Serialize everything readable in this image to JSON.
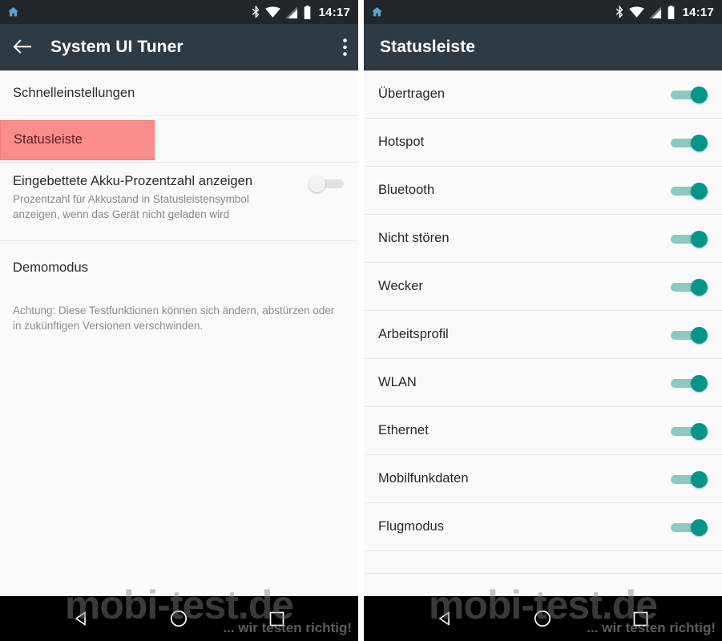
{
  "statusbar": {
    "home_icon": "home-icon",
    "bluetooth_icon": "bluetooth-icon",
    "wifi_icon": "wifi-icon",
    "signal_icon": "cellular-signal-icon",
    "battery_icon": "battery-icon",
    "time": "14:17"
  },
  "left_panel": {
    "appbar": {
      "back_icon": "back-arrow-icon",
      "title": "System UI Tuner",
      "overflow_icon": "overflow-menu-icon"
    },
    "items": [
      {
        "title": "Schnelleinstellungen",
        "type": "simple",
        "selected": false
      },
      {
        "title": "Statusleiste",
        "type": "simple",
        "selected": true
      },
      {
        "title": "Eingebettete Akku-Prozentzahl anzeigen",
        "subtitle": "Prozentzahl für Akkustand in Statusleistensymbol anzeigen, wenn das Gerät nicht geladen wird",
        "type": "switch",
        "switch_on": false
      },
      {
        "title": "Demomodus",
        "type": "section"
      }
    ],
    "note": "Achtung: Diese Testfunktionen können sich ändern, abstürzen oder in zukünftigen Versionen verschwinden."
  },
  "right_panel": {
    "appbar": {
      "title": "Statusleiste"
    },
    "items": [
      {
        "label": "Übertragen",
        "switch_on": true
      },
      {
        "label": "Hotspot",
        "switch_on": true
      },
      {
        "label": "Bluetooth",
        "switch_on": true
      },
      {
        "label": "Nicht stören",
        "switch_on": true
      },
      {
        "label": "Wecker",
        "switch_on": true
      },
      {
        "label": "Arbeitsprofil",
        "switch_on": true
      },
      {
        "label": "WLAN",
        "switch_on": true
      },
      {
        "label": "Ethernet",
        "switch_on": true
      },
      {
        "label": "Mobilfunkdaten",
        "switch_on": true
      },
      {
        "label": "Flugmodus",
        "switch_on": true
      }
    ]
  },
  "navbar": {
    "back_icon": "nav-back-triangle-icon",
    "home_icon": "nav-home-circle-icon",
    "recents_icon": "nav-recents-square-icon"
  },
  "watermark": {
    "main": "mobi-test.de",
    "sub": "... wir testen richtig!"
  },
  "colors": {
    "statusbar_bg": "#21272b",
    "appbar_bg": "#2e3b45",
    "content_bg": "#fafafa",
    "switch_on": "#069587",
    "switch_on_track": "#8cc9c0",
    "highlight": "#f98d8d",
    "navbar_bg": "#000000"
  }
}
